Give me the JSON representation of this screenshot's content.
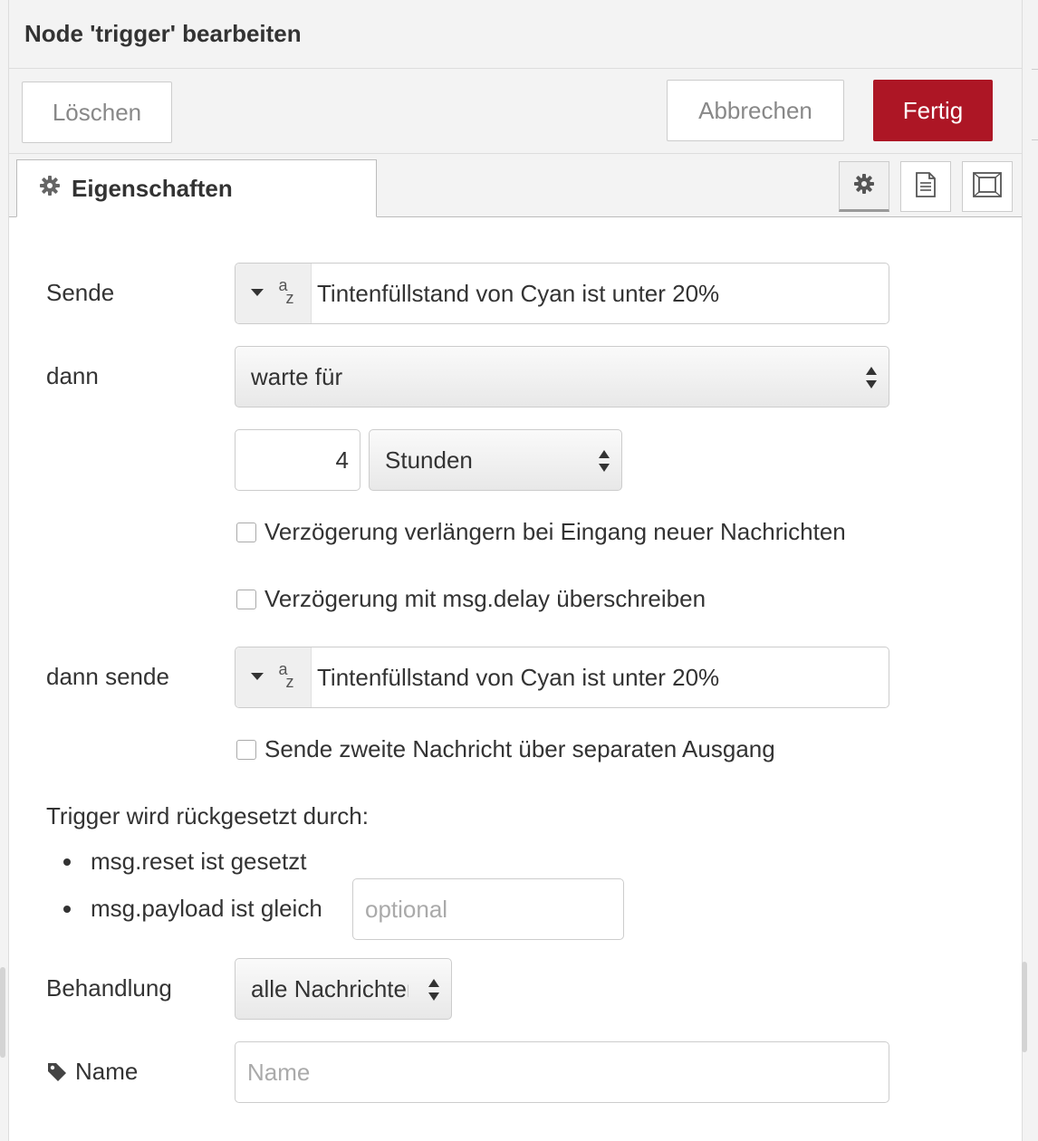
{
  "header": {
    "title": "Node 'trigger' bearbeiten"
  },
  "toolbar": {
    "delete_label": "Löschen",
    "cancel_label": "Abbrechen",
    "done_label": "Fertig"
  },
  "tabs": {
    "properties_label": "Eigenschaften"
  },
  "form": {
    "send_label": "Sende",
    "send_value": "Tintenfüllstand von Cyan ist unter 20%",
    "then_label": "dann",
    "then_value": "warte für",
    "duration_value": "4",
    "duration_unit": "Stunden",
    "extend_delay_label": "Verzögerung verlängern bei Eingang neuer Nachrichten",
    "override_delay_label": "Verzögerung mit msg.delay überschreiben",
    "then_send_label": "dann sende",
    "then_send_value": "Tintenfüllstand von Cyan ist unter 20%",
    "second_output_label": "Sende zweite Nachricht über separaten Ausgang",
    "reset_heading": "Trigger wird rückgesetzt durch:",
    "reset_item_1": "msg.reset ist gesetzt",
    "reset_item_2": "msg.payload ist gleich",
    "reset_payload_placeholder": "optional",
    "handling_label": "Behandlung",
    "handling_value": "alle Nachrichten",
    "name_label": "Name",
    "name_placeholder": "Name"
  },
  "colors": {
    "primary": "#ad1625",
    "background": "#f3f3f3",
    "border": "#cccccc"
  },
  "icons": {
    "gear": "gear-icon",
    "info": "document-icon",
    "appearance": "frame-icon",
    "tag": "tag-icon",
    "caret": "caret-down-icon",
    "type": "string-type-icon",
    "updown": "select-arrows-icon"
  }
}
